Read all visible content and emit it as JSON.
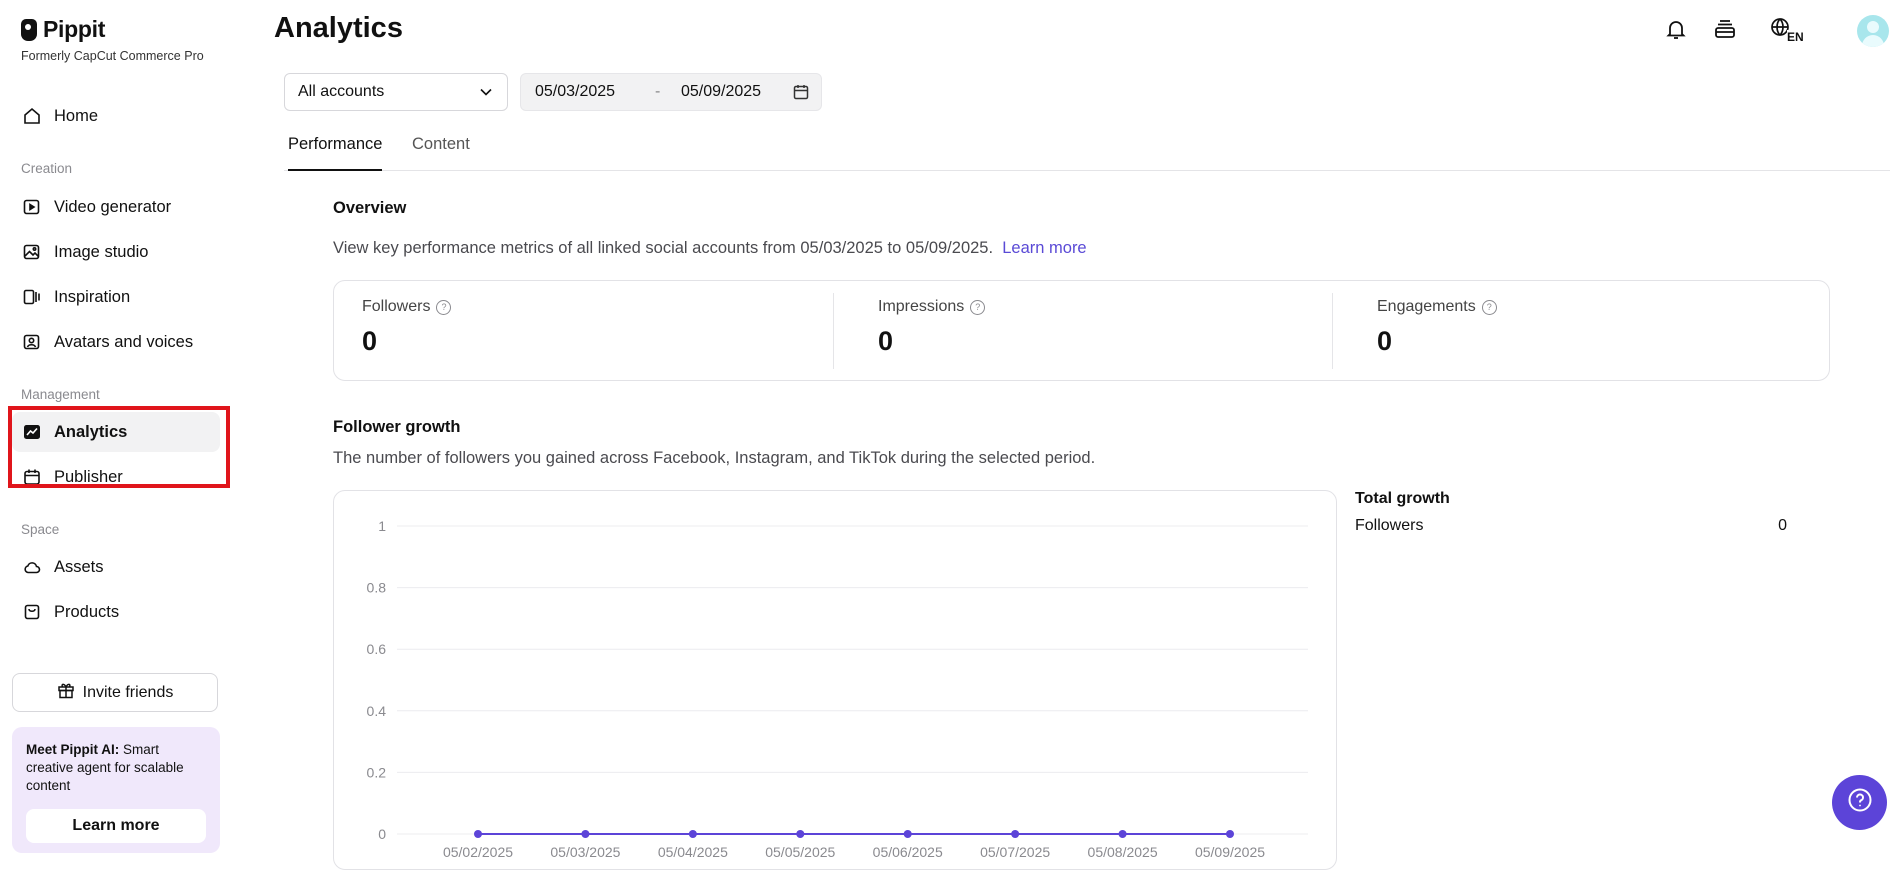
{
  "brand": {
    "name": "Pippit",
    "subtitle": "Formerly CapCut Commerce Pro"
  },
  "sidebar": {
    "home": "Home",
    "section_creation": "Creation",
    "video_generator": "Video generator",
    "image_studio": "Image studio",
    "inspiration": "Inspiration",
    "avatars_voices": "Avatars and voices",
    "section_management": "Management",
    "analytics": "Analytics",
    "publisher": "Publisher",
    "section_space": "Space",
    "assets": "Assets",
    "products": "Products",
    "invite": "Invite friends",
    "promo_bold": "Meet Pippit AI:",
    "promo_rest": " Smart creative agent for scalable content",
    "promo_button": "Learn more"
  },
  "header": {
    "title": "Analytics",
    "lang": "EN"
  },
  "filters": {
    "account": "All accounts",
    "date_start": "05/03/2025",
    "date_sep": "-",
    "date_end": "05/09/2025"
  },
  "tabs": {
    "performance": "Performance",
    "content": "Content"
  },
  "overview": {
    "title": "Overview",
    "desc": "View key performance metrics of all linked social accounts from 05/03/2025 to 05/09/2025.",
    "learn_more": "Learn more",
    "metrics": [
      {
        "label": "Followers",
        "value": "0"
      },
      {
        "label": "Impressions",
        "value": "0"
      },
      {
        "label": "Engagements",
        "value": "0"
      }
    ]
  },
  "growth": {
    "title": "Follower growth",
    "desc": "The number of followers you gained across Facebook, Instagram, and TikTok during the selected period.",
    "total_title": "Total growth",
    "total_label": "Followers",
    "total_value": "0"
  },
  "chart_data": {
    "type": "line",
    "title": "",
    "xlabel": "",
    "ylabel": "",
    "x": [
      "05/02/2025",
      "05/03/2025",
      "05/04/2025",
      "05/05/2025",
      "05/06/2025",
      "05/07/2025",
      "05/08/2025",
      "05/09/2025"
    ],
    "y_ticks": [
      "0",
      "0.2",
      "0.4",
      "0.6",
      "0.8",
      "1"
    ],
    "ylim": [
      0,
      1
    ],
    "grid": true,
    "series": [
      {
        "values": [
          0,
          0,
          0,
          0,
          0,
          0,
          0,
          0
        ],
        "color": "#5c44d8"
      }
    ]
  },
  "colors": {
    "accent": "#5c44d8",
    "highlight": "#e0151b",
    "promo_bg": "#f0e8fb"
  }
}
